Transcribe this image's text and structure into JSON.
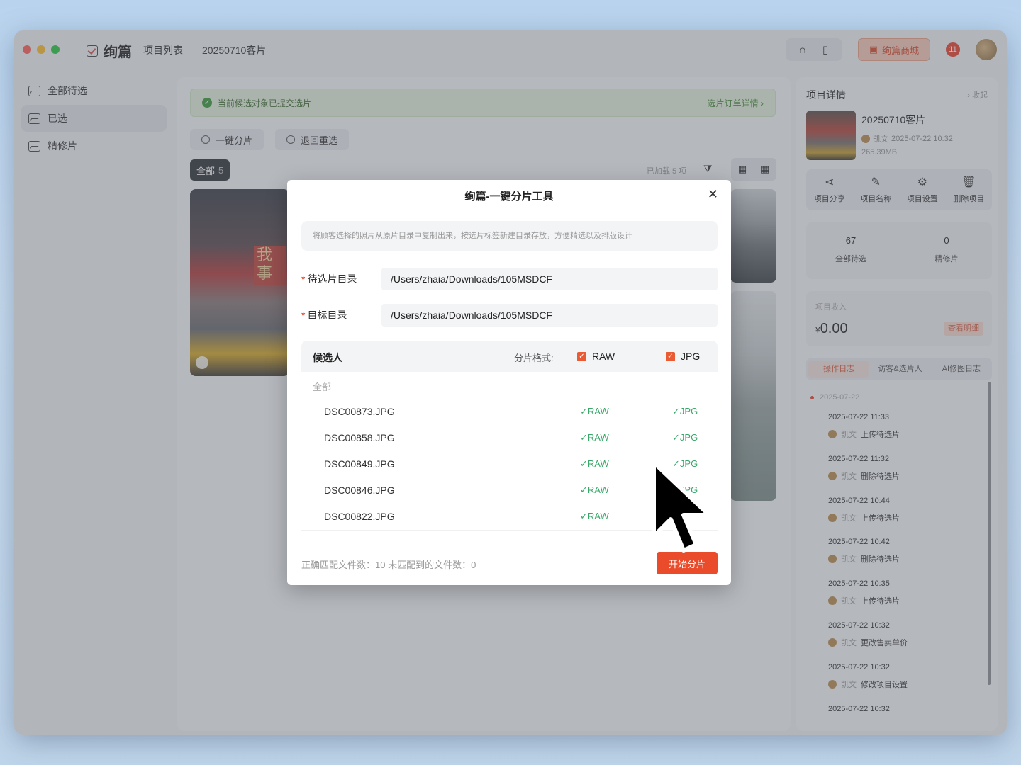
{
  "titlebar": {
    "app_name": "绚篇",
    "nav": [
      "项目列表",
      "20250710客片"
    ],
    "mall_label": "绚篇商城",
    "notification_count": "11"
  },
  "sidebar": {
    "items": [
      {
        "label": "全部待选",
        "active": false
      },
      {
        "label": "已选",
        "active": true
      },
      {
        "label": "精修片",
        "active": false
      }
    ]
  },
  "main": {
    "notice": "当前候选对象已提交选片",
    "notice_link": "选片订单详情 ›",
    "actions": [
      "一键分片",
      "退回重选"
    ],
    "tab_all_label": "全部",
    "tab_all_count": "5",
    "loaded_text": "已加载 5 项",
    "photo_sign_text": "我 事"
  },
  "right_panel": {
    "title": "项目详情",
    "collapse": "› 收起",
    "project_name": "20250710客片",
    "owner": "凯文",
    "created": "2025-07-22 10:32",
    "size": "265.39MB",
    "actions": [
      {
        "icon": "share-icon",
        "label": "项目分享"
      },
      {
        "icon": "edit-icon",
        "label": "项目名称"
      },
      {
        "icon": "gear-icon",
        "label": "项目设置"
      },
      {
        "icon": "trash-icon",
        "label": "删除项目"
      }
    ],
    "stats": [
      {
        "num": "67",
        "label": "全部待选"
      },
      {
        "num": "0",
        "label": "精修片"
      }
    ],
    "income_label": "项目收入",
    "income_currency": "¥",
    "income_value": "0.00",
    "income_detail": "查看明细",
    "log_tabs": [
      "操作日志",
      "访客&选片人",
      "AI修图日志"
    ],
    "log_date": "2025-07-22",
    "logs": [
      {
        "time": "2025-07-22 11:33",
        "user": "凯文",
        "action": "上传待选片"
      },
      {
        "time": "2025-07-22 11:32",
        "user": "凯文",
        "action": "删除待选片"
      },
      {
        "time": "2025-07-22 10:44",
        "user": "凯文",
        "action": "上传待选片"
      },
      {
        "time": "2025-07-22 10:42",
        "user": "凯文",
        "action": "删除待选片"
      },
      {
        "time": "2025-07-22 10:35",
        "user": "凯文",
        "action": "上传待选片"
      },
      {
        "time": "2025-07-22 10:32",
        "user": "凯文",
        "action": "更改售卖单价"
      },
      {
        "time": "2025-07-22 10:32",
        "user": "凯文",
        "action": "修改项目设置"
      },
      {
        "time": "2025-07-22 10:32",
        "user": "",
        "action": ""
      }
    ]
  },
  "dialog": {
    "title": "绚篇-一键分片工具",
    "description": "将顾客选择的照片从原片目录中复制出来，按选片标签新建目录存放，方便精选以及排版设计",
    "source_label": "待选片目录",
    "source_value": "/Users/zhaia/Downloads/105MSDCF",
    "target_label": "目标目录",
    "target_value": "/Users/zhaia/Downloads/105MSDCF",
    "list_title": "候选人",
    "format_label": "分片格式:",
    "format_raw": "RAW",
    "format_jpg": "JPG",
    "group_label": "全部",
    "files": [
      {
        "name": "DSC00873.JPG",
        "raw": "✓RAW",
        "jpg": "✓JPG"
      },
      {
        "name": "DSC00858.JPG",
        "raw": "✓RAW",
        "jpg": "✓JPG"
      },
      {
        "name": "DSC00849.JPG",
        "raw": "✓RAW",
        "jpg": "✓JPG"
      },
      {
        "name": "DSC00846.JPG",
        "raw": "✓RAW",
        "jpg": "✓JPG"
      },
      {
        "name": "DSC00822.JPG",
        "raw": "✓RAW",
        "jpg": ""
      }
    ],
    "footer_info": "正确匹配文件数：10 未匹配到的文件数：0",
    "start_label": "开始分片"
  }
}
